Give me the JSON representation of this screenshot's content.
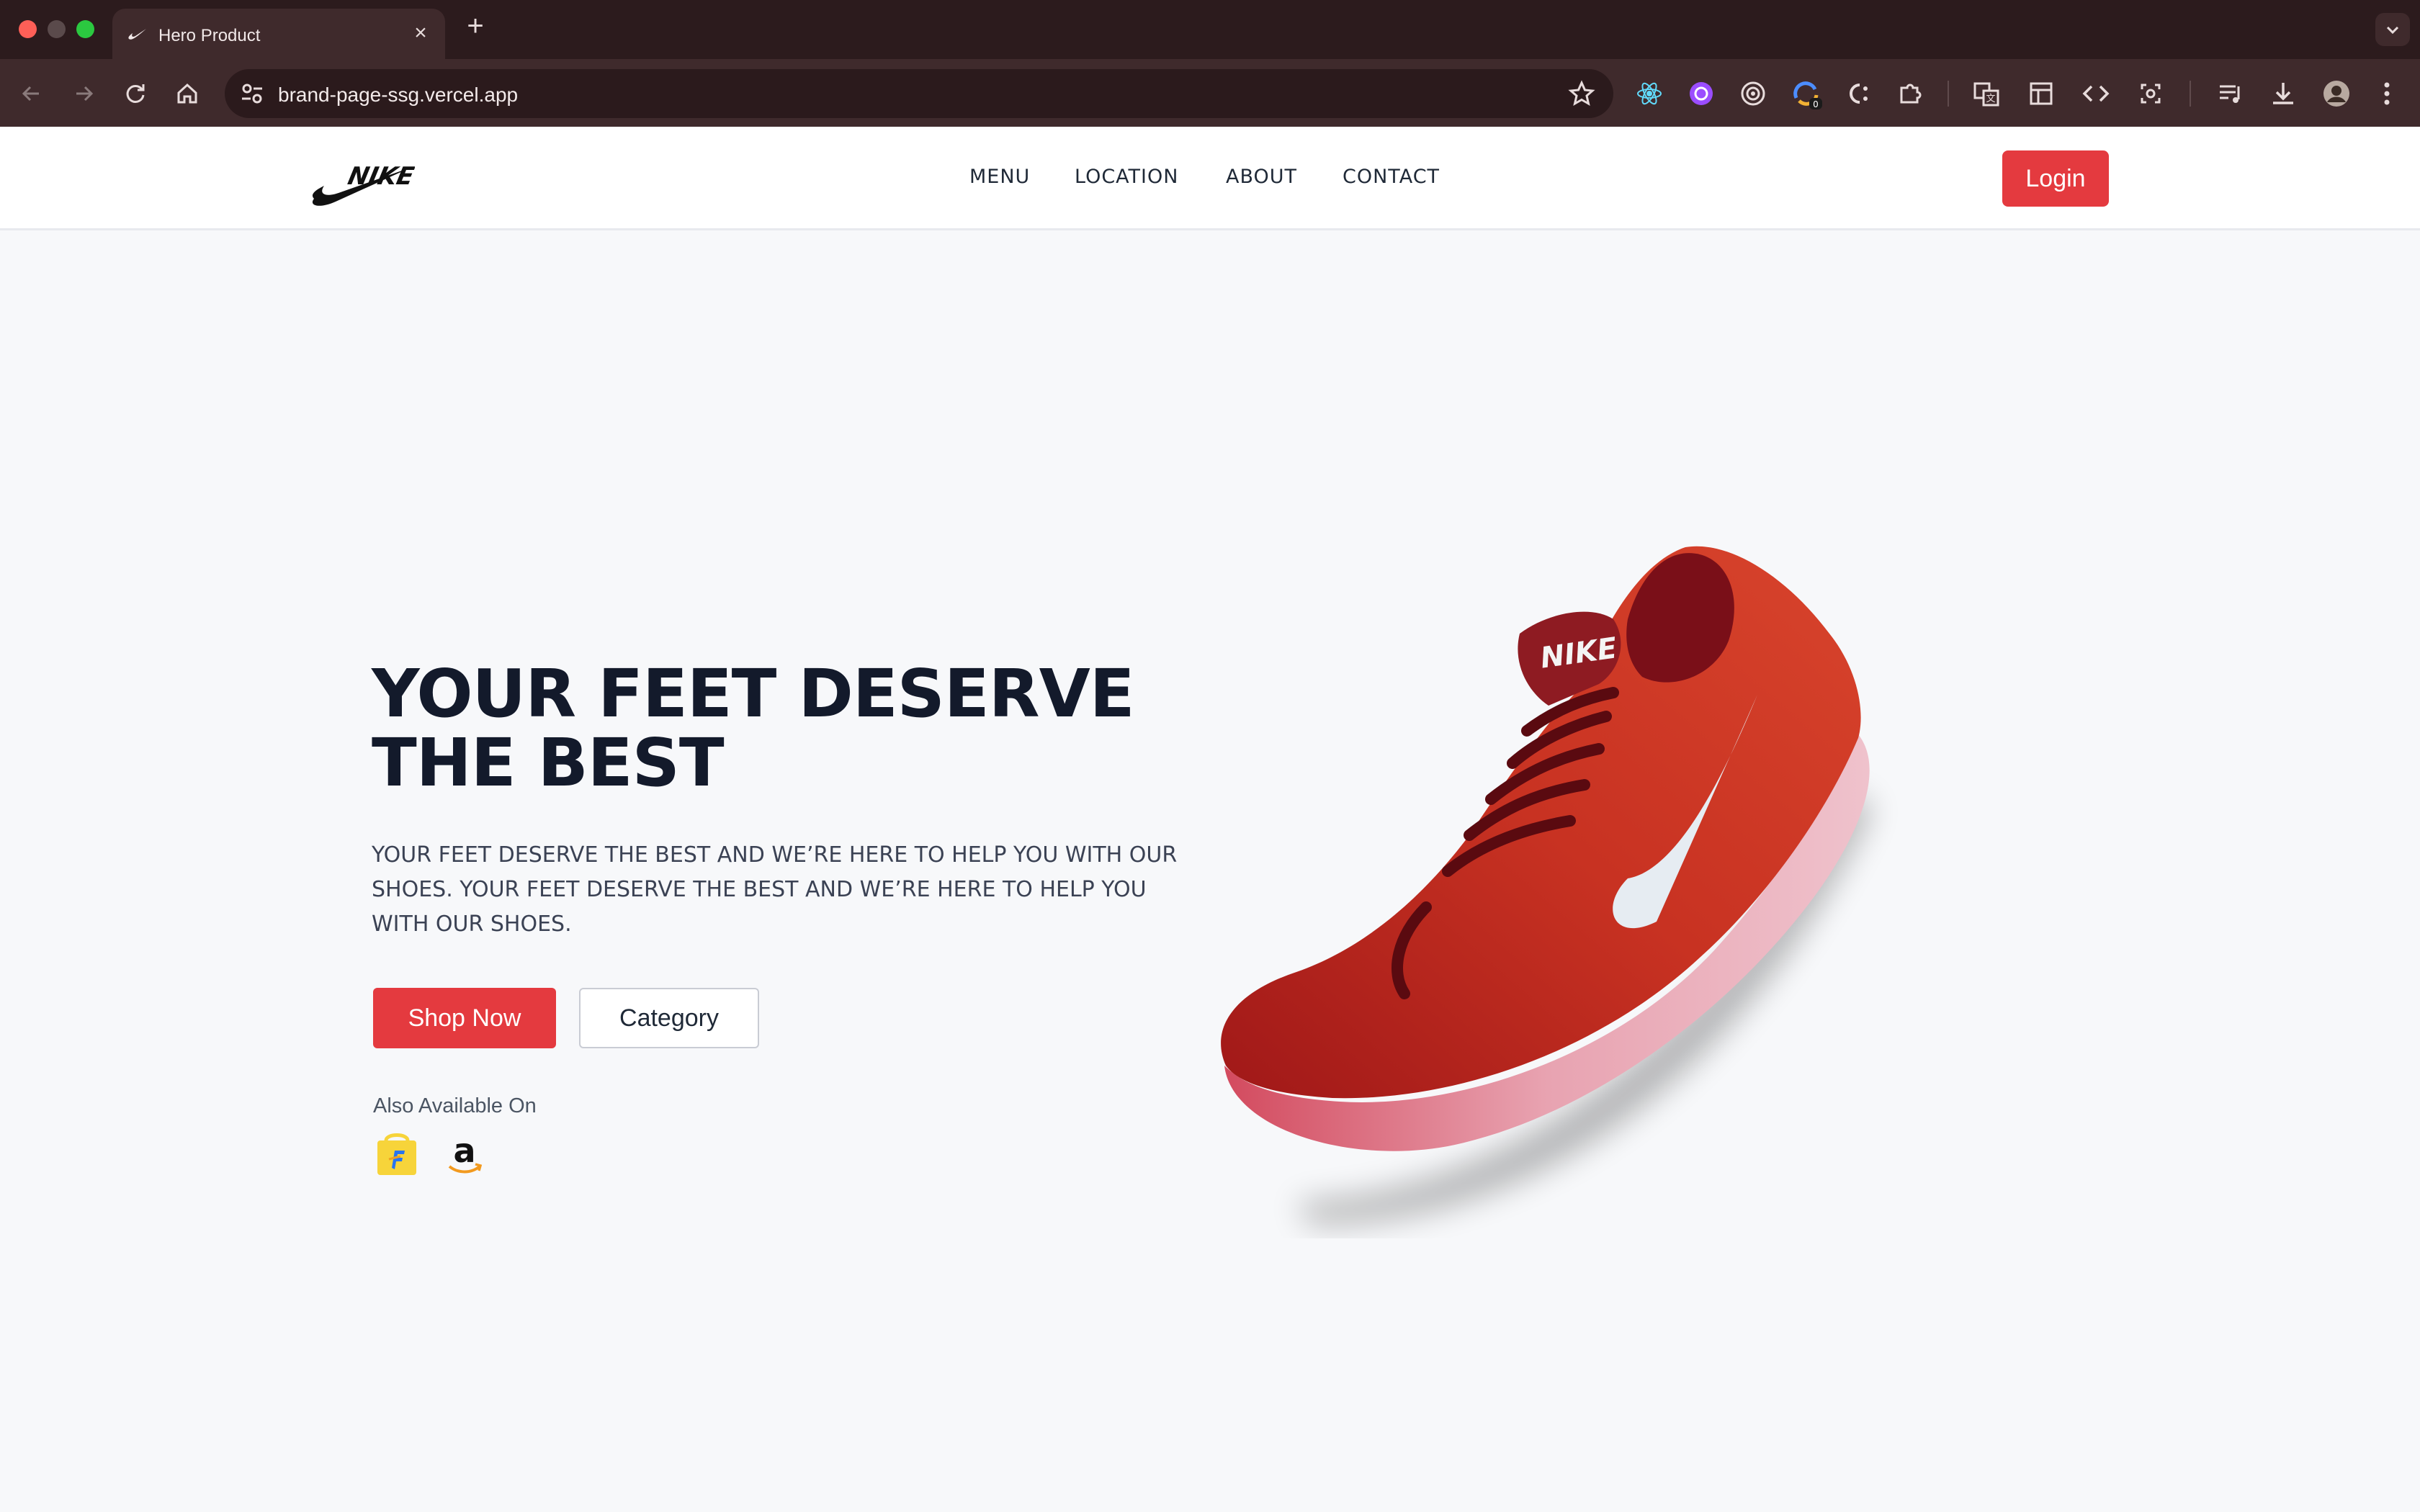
{
  "browser": {
    "tab_title": "Hero Product",
    "url": "brand-page-ssg.vercel.app",
    "new_tab_label": "+",
    "close_label": "×"
  },
  "header": {
    "nav": [
      {
        "label": "MENU"
      },
      {
        "label": "LOCATION"
      },
      {
        "label": "ABOUT"
      },
      {
        "label": "CONTACT"
      }
    ],
    "login_label": "Login"
  },
  "hero": {
    "title": "YOUR FEET DESERVE THE BEST",
    "description": "YOUR FEET DESERVE THE BEST AND WE’RE HERE TO HELP YOU WITH OUR SHOES. YOUR FEET DESERVE THE BEST AND WE’RE HERE TO HELP YOU WITH OUR SHOES.",
    "primary_button": "Shop Now",
    "secondary_button": "Category",
    "available_label": "Also Available On",
    "stores": [
      {
        "icon": "flipkart-icon"
      },
      {
        "icon": "amazon-icon"
      }
    ]
  },
  "colors": {
    "accent": "#e43a3f",
    "title": "#131a2b",
    "background": "#f7f8fa",
    "chrome": "#2c1b1d"
  }
}
